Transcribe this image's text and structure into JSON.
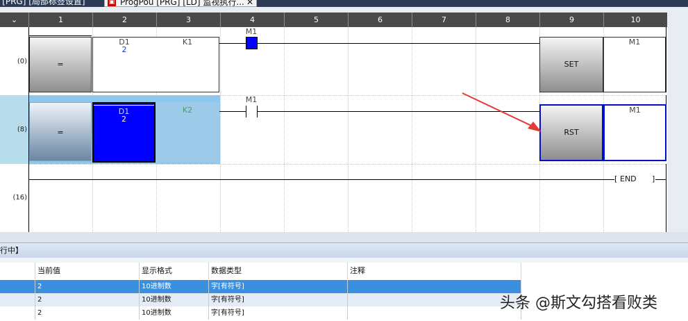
{
  "tabs": {
    "left_label": "i [PRG] [局部标签设置]",
    "active_label": "ProgPou [PRG] [LD] 监视执行...",
    "close_glyph": "✕"
  },
  "column_header": {
    "collapse_glyph": "⌄",
    "columns": [
      "1",
      "2",
      "3",
      "4",
      "5",
      "6",
      "7",
      "8",
      "9",
      "10"
    ]
  },
  "ladder": {
    "steps": [
      {
        "step": "(0)"
      },
      {
        "step": "(8)"
      },
      {
        "step": "(16)"
      }
    ],
    "rung0": {
      "compare_op": "=",
      "op1_device": "D1",
      "op1_value": "2",
      "op2_device": "K1",
      "contact_device": "M1",
      "coil_instruction": "SET",
      "coil_device": "M1"
    },
    "rung1": {
      "compare_op": "=",
      "op1_device": "D1",
      "op1_value": "2",
      "op2_device": "K2",
      "contact_device": "M1",
      "coil_instruction": "RST",
      "coil_device": "M1"
    },
    "rung2": {
      "end_label": "END"
    }
  },
  "watch": {
    "title": "行中】",
    "headers": [
      "当前值",
      "显示格式",
      "数据类型",
      "注释"
    ],
    "rows": [
      {
        "value": "2",
        "format": "10进制数",
        "type": "字[有符号]",
        "comment": ""
      },
      {
        "value": "2",
        "format": "10进制数",
        "type": "字[有符号]",
        "comment": ""
      },
      {
        "value": "2",
        "format": "10进制数",
        "type": "字[有符号]",
        "comment": ""
      }
    ]
  },
  "watermark": "头条 @斯文勾搭看败类",
  "colors": {
    "selection_blue": "#0000ff",
    "highlight_light": "#8fc7ec",
    "arrow_red": "#e53935",
    "row_selected": "#3b8fe0"
  }
}
